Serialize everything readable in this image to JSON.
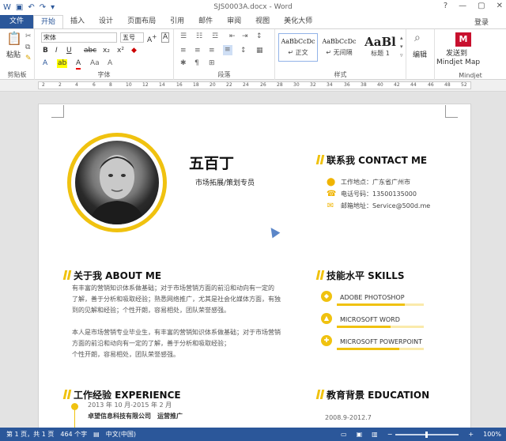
{
  "window": {
    "title": "SJS0003A.docx - Word",
    "controls": [
      "?",
      "—",
      "▢",
      "✕"
    ]
  },
  "tabs": {
    "file": "文件",
    "items": [
      "开始",
      "插入",
      "设计",
      "页面布局",
      "引用",
      "邮件",
      "审阅",
      "视图",
      "美化大师"
    ],
    "active": "开始",
    "login": "登录"
  },
  "ribbon": {
    "clipboard": {
      "paste": "粘贴",
      "group": "剪贴板"
    },
    "font": {
      "family": "宋体",
      "size": "五号",
      "group": "字体"
    },
    "paragraph": {
      "group": "段落"
    },
    "styles": {
      "items": [
        {
          "preview": "AaBbCcDc",
          "name": "↵ 正文"
        },
        {
          "preview": "AaBbCcDc",
          "name": "↵ 无间隔"
        },
        {
          "preview": "AaBl",
          "name": "标题 1"
        }
      ],
      "group": "样式"
    },
    "edit": {
      "label": "编辑"
    },
    "mindjet": {
      "label1": "发送到",
      "label2": "Mindjet Map",
      "group": "Mindjet"
    }
  },
  "ruler": {
    "ticks": [
      "2",
      "2",
      "4",
      "6",
      "8",
      "10",
      "12",
      "14",
      "16",
      "18",
      "20",
      "22",
      "24",
      "26",
      "28",
      "30",
      "32",
      "34",
      "36",
      "38",
      "40",
      "42",
      "44",
      "46",
      "48",
      "52"
    ]
  },
  "resume": {
    "name": "五百丁",
    "role": "市场拓展/策划专员",
    "contact": {
      "title": "联系我 CONTACT ME",
      "address": "工作地点：广东省广州市",
      "phone": "电话号码：13500135000",
      "email": "邮箱地址：Service@500d.me"
    },
    "about": {
      "title": "关于我 ABOUT ME",
      "p1_l1": "有丰富的营销知识体系做基础；对于市场营销方面的前沿和动向有一定的",
      "p1_l2": "了解，善于分析和吸取经验；熟悉网络推广，尤其是社会化媒体方面，有独",
      "p1_l3": "到的见解和经验；个性开朗，容易相处，团队荣誉感强。",
      "p2_l1": "本人是市场营销专业毕业生，有丰富的营销知识体系做基础；对于市场营销",
      "p2_l2": "方面的前沿和动向有一定的了解，善于分析和吸取经验；",
      "p2_l3": "个性开朗，容易相处，团队荣誉感强。"
    },
    "skills": {
      "title": "技能水平 SKILLS",
      "items": [
        {
          "name": "ADOBE PHOTOSHOP",
          "level": 0.78
        },
        {
          "name": "MICROSOFT WORD",
          "level": 0.62
        },
        {
          "name": "MICROSOFT POWERPOINT",
          "level": 0.72
        }
      ]
    },
    "experience": {
      "title": "工作经验 EXPERIENCE",
      "date": "2013 年 10 月-2015 年 2 月",
      "company": "卓望信息科技有限公司　运营推广"
    },
    "education": {
      "title": "教育背景 EDUCATION",
      "date": "2008.9-2012.7"
    }
  },
  "status": {
    "page": "第 1 页，共 1 页",
    "words": "464 个字",
    "lang": "中文(中国)",
    "zoom": "100%"
  }
}
